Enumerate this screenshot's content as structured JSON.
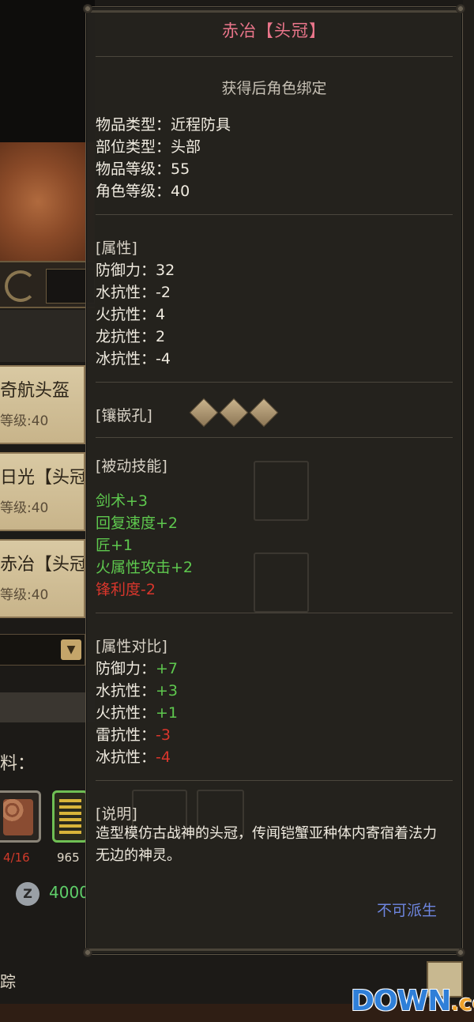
{
  "tooltip": {
    "title": "赤冶【头冠】",
    "bind_note": "获得后角色绑定",
    "info": [
      {
        "label": "物品类型：",
        "value": "近程防具"
      },
      {
        "label": "部位类型：",
        "value": "头部"
      },
      {
        "label": "物品等级：",
        "value": "55"
      },
      {
        "label": "角色等级：",
        "value": "40"
      }
    ],
    "attributes": {
      "header": "[属性]",
      "items": [
        {
          "label": "防御力：",
          "value": "32"
        },
        {
          "label": "水抗性：",
          "value": "-2"
        },
        {
          "label": "火抗性：",
          "value": "4"
        },
        {
          "label": "龙抗性：",
          "value": "2"
        },
        {
          "label": "冰抗性：",
          "value": "-4"
        }
      ]
    },
    "sockets": {
      "header": "[镶嵌孔]",
      "count": 3
    },
    "passive": {
      "header": "[被动技能]",
      "items": [
        {
          "text": "剑术+3",
          "color": "#5ec84e"
        },
        {
          "text": "回复速度+2",
          "color": "#5ec84e"
        },
        {
          "text": "匠+1",
          "color": "#5ec84e"
        },
        {
          "text": "火属性攻击+2",
          "color": "#5ec84e"
        },
        {
          "text": "锋利度-2",
          "color": "#d9362c"
        }
      ]
    },
    "compare": {
      "header": "[属性对比]",
      "items": [
        {
          "label": "防御力：",
          "value": "+7",
          "color": "#5ec84e"
        },
        {
          "label": "水抗性：",
          "value": "+3",
          "color": "#5ec84e"
        },
        {
          "label": "火抗性：",
          "value": "+1",
          "color": "#5ec84e"
        },
        {
          "label": "雷抗性：",
          "value": "-3",
          "color": "#d9362c"
        },
        {
          "label": "冰抗性：",
          "value": "-4",
          "color": "#d9362c"
        }
      ]
    },
    "description": {
      "header": "[说明]",
      "text": "造型模仿古战神的头冠，传闻铠蟹亚种体内寄宿着法力无边的神灵。"
    },
    "footer_note": "不可派生"
  },
  "background": {
    "cards": [
      {
        "name": "奇航头盔",
        "level": "等级:40"
      },
      {
        "name": "日光【头冠",
        "level": "等级:40"
      },
      {
        "name": "赤冶【头冠",
        "level": "等级:40"
      }
    ],
    "materials_label": "料：",
    "material1_count": "4/16",
    "material2_count": "965",
    "coin_symbol": "Z",
    "coin_amount": "4000",
    "track_label": "踪"
  },
  "watermark": {
    "main": "DOWN",
    "suffix": ".cc"
  }
}
